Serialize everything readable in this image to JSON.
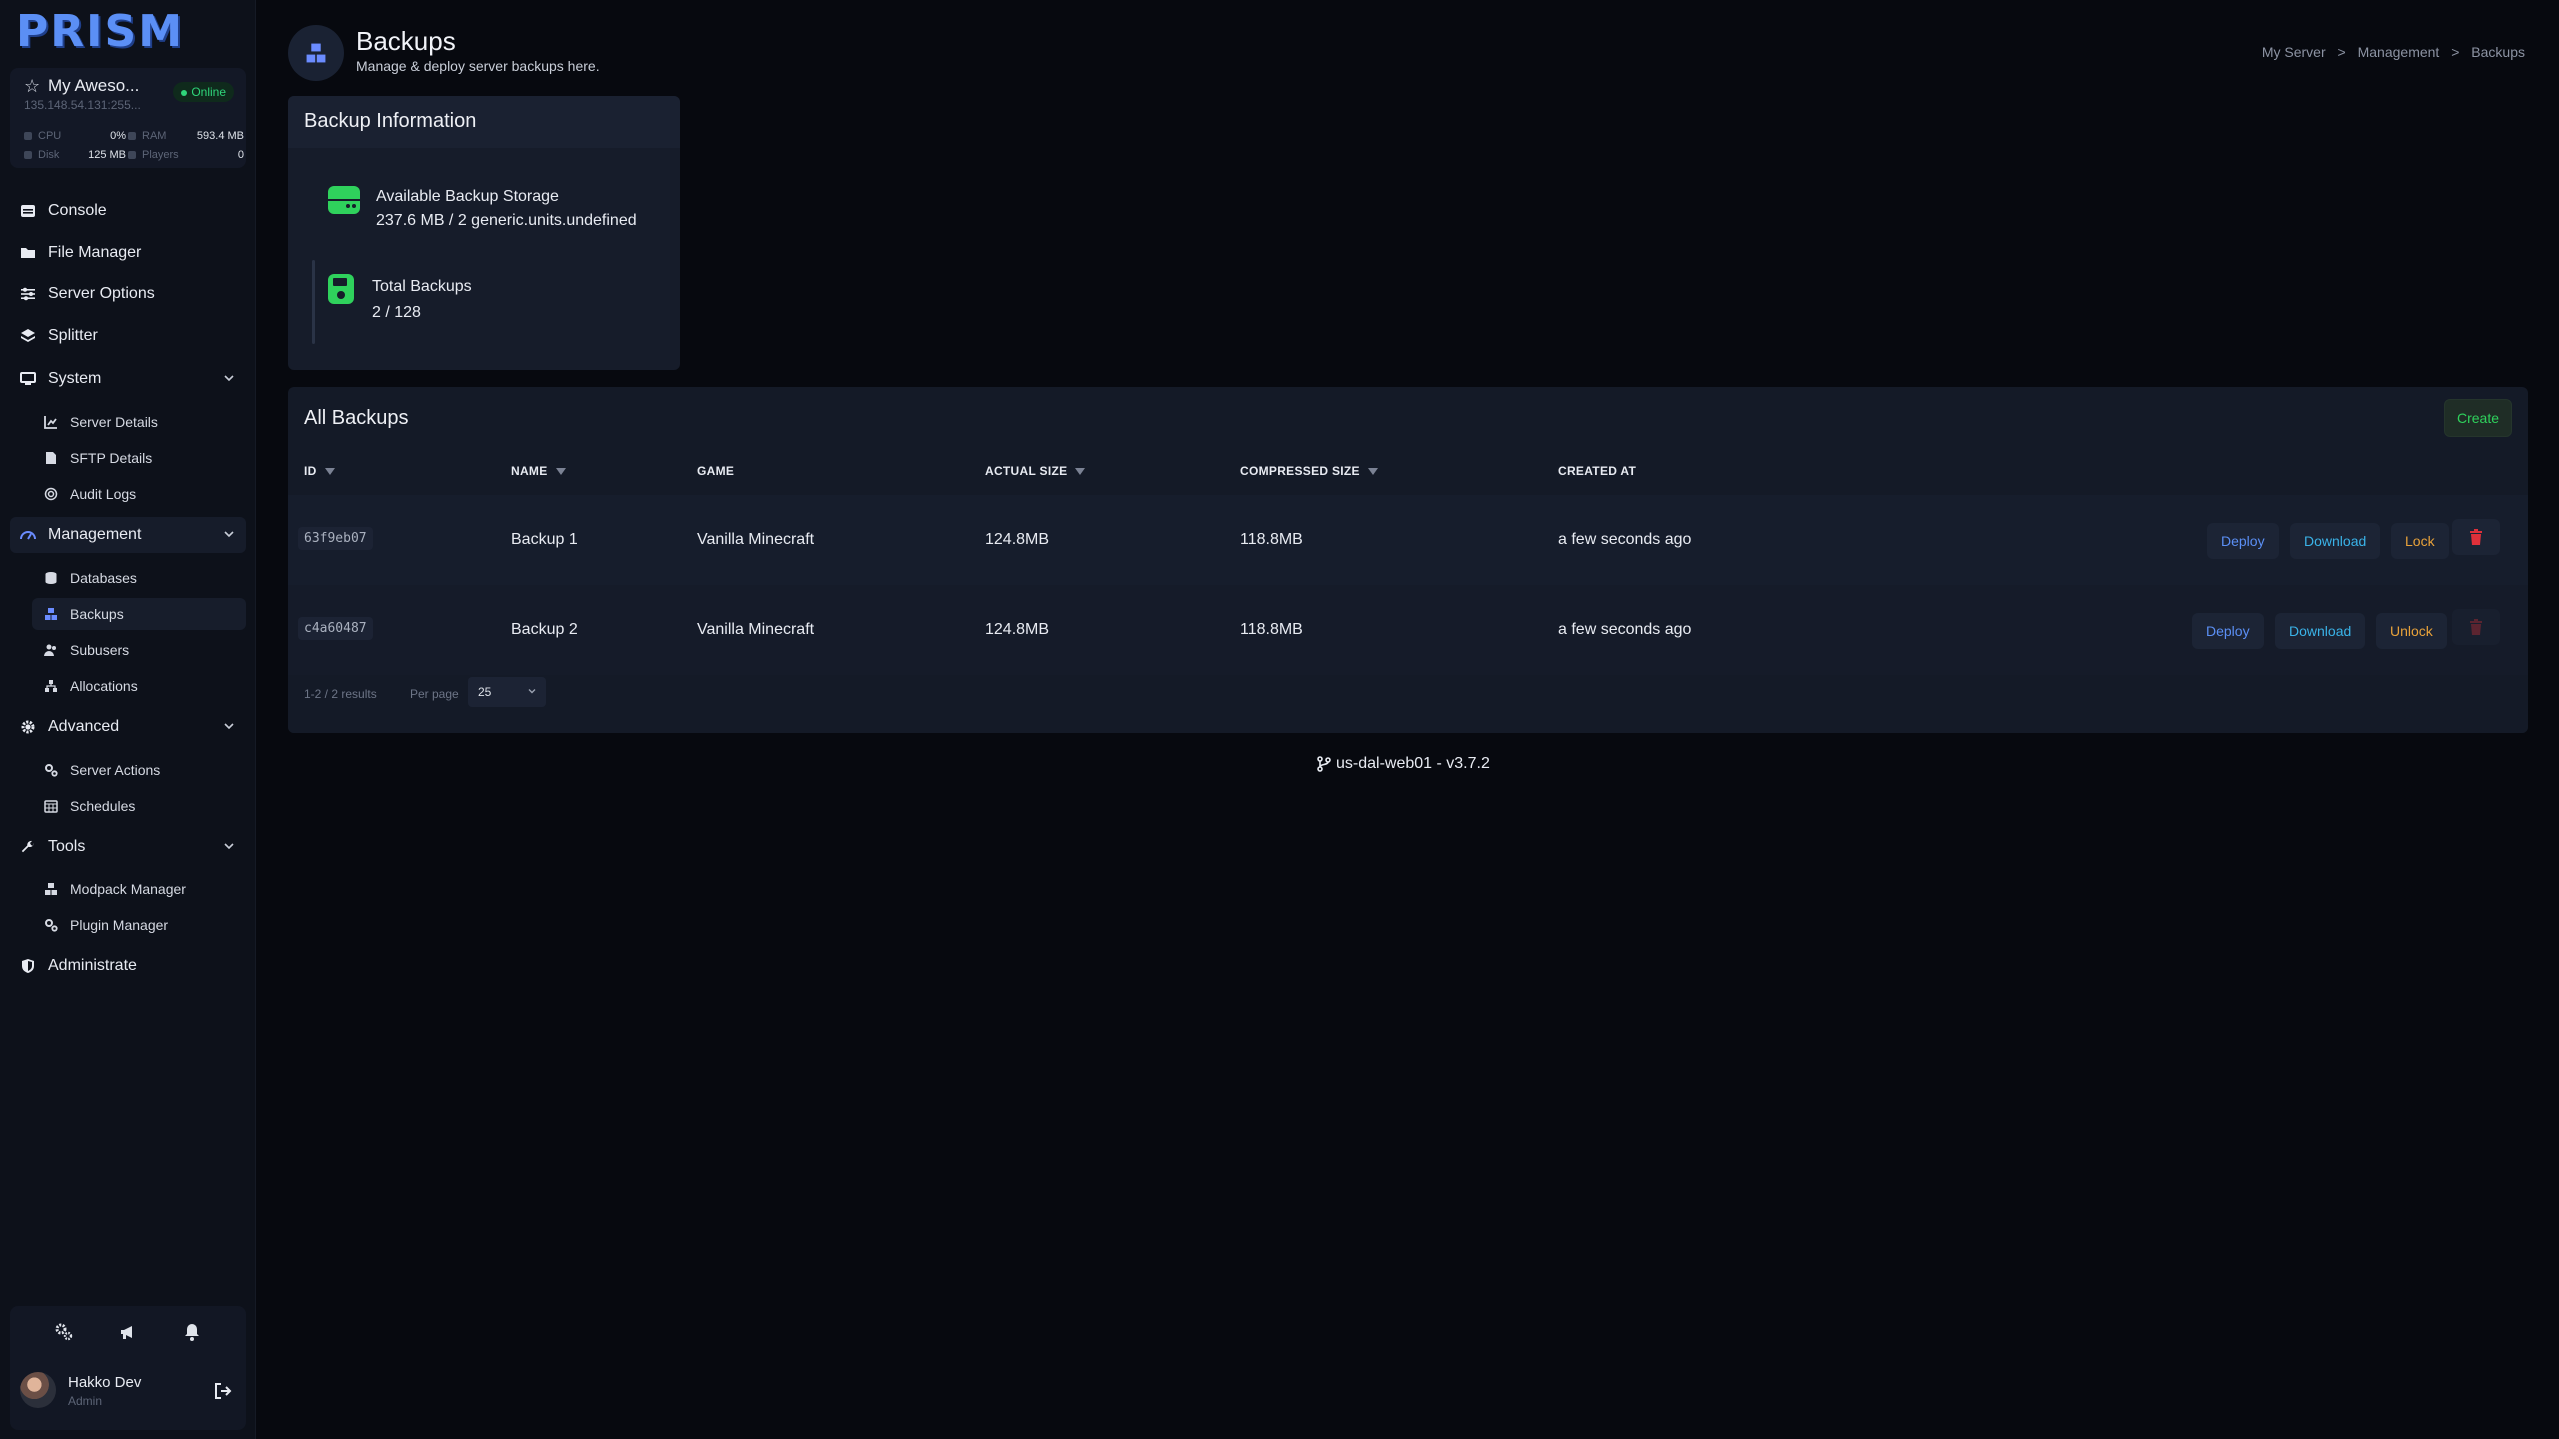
{
  "brand": {
    "logo": "PRISM"
  },
  "server": {
    "name": "My Aweso...",
    "status": "Online",
    "ip": "135.148.54.131:255...",
    "stats": [
      {
        "label": "CPU",
        "value": "0%"
      },
      {
        "label": "RAM",
        "value": "593.4 MB"
      },
      {
        "label": "Disk",
        "value": "125 MB"
      },
      {
        "label": "Players",
        "value": "0"
      }
    ]
  },
  "nav": {
    "console": "Console",
    "file_manager": "File Manager",
    "server_options": "Server Options",
    "splitter": "Splitter",
    "system": "System",
    "system_items": [
      "Server Details",
      "SFTP Details",
      "Audit Logs"
    ],
    "management": "Management",
    "management_items": [
      "Databases",
      "Backups",
      "Subusers",
      "Allocations"
    ],
    "advanced": "Advanced",
    "advanced_items": [
      "Server Actions",
      "Schedules"
    ],
    "tools": "Tools",
    "tools_items": [
      "Modpack Manager",
      "Plugin Manager"
    ],
    "administrate": "Administrate"
  },
  "user": {
    "name": "Hakko Dev",
    "role": "Admin"
  },
  "header": {
    "title": "Backups",
    "subtitle": "Manage & deploy server backups here.",
    "breadcrumb": [
      "My Server",
      "Management",
      "Backups"
    ],
    "separator": ">"
  },
  "info": {
    "title": "Backup Information",
    "storage_label": "Available Backup Storage",
    "storage_value": "237.6 MB / 2 generic.units.undefined",
    "total_label": "Total Backups",
    "total_value": "2 / 128"
  },
  "backups": {
    "title": "All Backups",
    "create_label": "Create",
    "columns": [
      "ID",
      "NAME",
      "GAME",
      "ACTUAL SIZE",
      "COMPRESSED SIZE",
      "CREATED AT"
    ],
    "rows": [
      {
        "id": "63f9eb07",
        "name": "Backup 1",
        "game": "Vanilla Minecraft",
        "actual": "124.8MB",
        "compressed": "118.8MB",
        "created": "a few seconds ago",
        "lock_label": "Lock"
      },
      {
        "id": "c4a60487",
        "name": "Backup 2",
        "game": "Vanilla Minecraft",
        "actual": "124.8MB",
        "compressed": "118.8MB",
        "created": "a few seconds ago",
        "lock_label": "Unlock"
      }
    ],
    "deploy_label": "Deploy",
    "download_label": "Download",
    "pagination": "1-2  /  2 results",
    "per_page_label": "Per page",
    "per_page_value": "25"
  },
  "footer": {
    "version": "us-dal-web01 - v3.7.2"
  },
  "colors": {
    "accent": "#5b8ff5",
    "success": "#2fd15c",
    "warning": "#e8a23a",
    "danger": "#e0303a"
  }
}
